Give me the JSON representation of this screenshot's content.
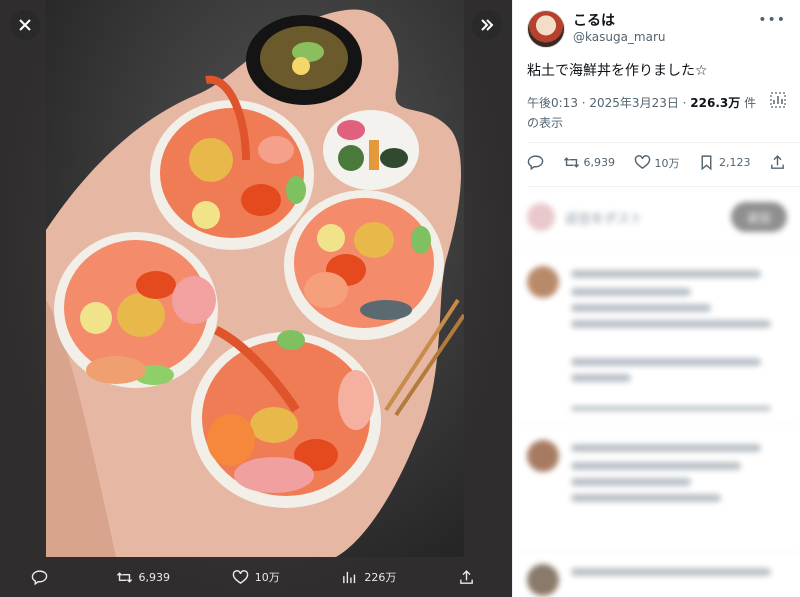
{
  "viewer": {
    "close_icon": "close-icon",
    "expand_icon": "chevrons-right-icon",
    "bar": {
      "reply_label": "",
      "retweet_count": "6,939",
      "like_count": "10万",
      "views_count": "226万",
      "share_label": ""
    }
  },
  "post": {
    "author_name": "こるは",
    "author_handle": "@kasuga_maru",
    "text": "粘土で海鮮丼を作りました☆",
    "time_date": "午後0:13 · 2025年3月23日 · ",
    "views_value": "226.3万",
    "views_label": " 件の表示",
    "more_icon": "more-icon",
    "actions": {
      "retweet_count": "6,939",
      "like_count": "10万",
      "bookmark_count": "2,123"
    }
  },
  "replies": {
    "reply_placeholder": "返信をポスト",
    "reply_button": "返信"
  },
  "colors": {
    "text_primary": "#0f1419",
    "text_secondary": "#536471",
    "viewer_bg": "#3c3a3b"
  }
}
